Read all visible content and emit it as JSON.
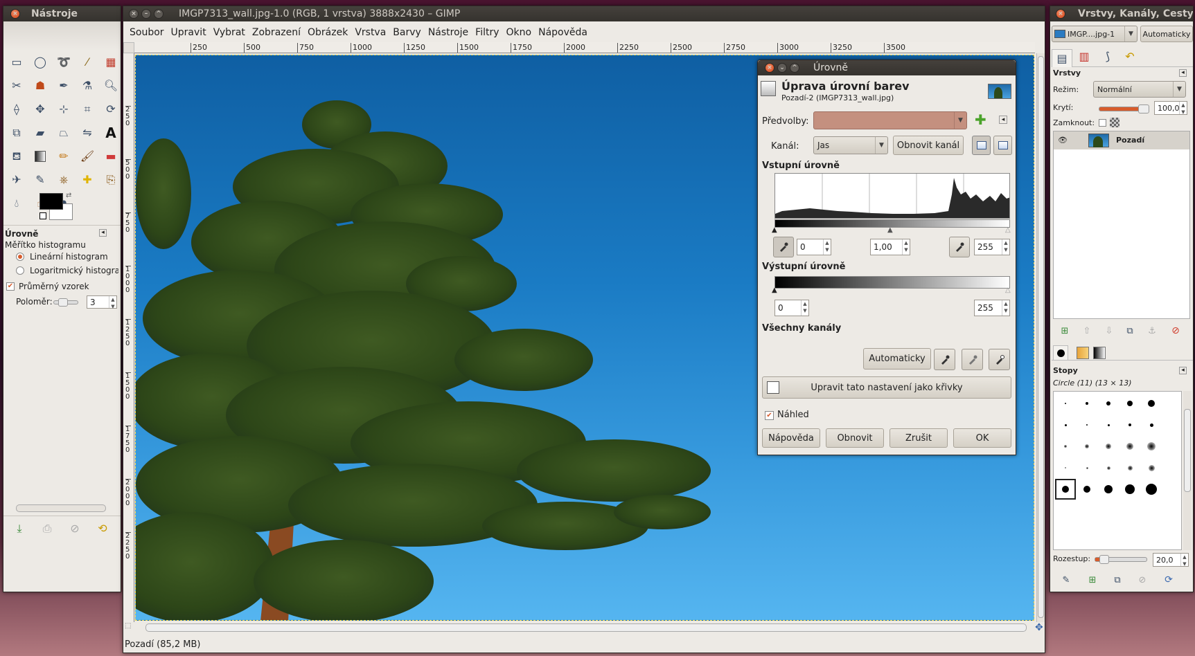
{
  "toolbox": {
    "title": "Nástroje",
    "options_title": "Úrovně",
    "histogram_scale_label": "Měřítko histogramu",
    "linear_label": "Lineární histogram",
    "log_label": "Logaritmický histogram",
    "sample_average_label": "Průměrný vzorek",
    "radius_label": "Poloměr:",
    "radius_value": "3"
  },
  "main": {
    "title": "IMGP7313_wall.jpg-1.0 (RGB, 1 vrstva) 3888x2430 – GIMP",
    "menu": [
      "Soubor",
      "Upravit",
      "Vybrat",
      "Zobrazení",
      "Obrázek",
      "Vrstva",
      "Barvy",
      "Nástroje",
      "Filtry",
      "Okno",
      "Nápověda"
    ],
    "ruler_ticks": [
      "250",
      "500",
      "750",
      "1000",
      "1250",
      "1500",
      "1750",
      "2000",
      "2250",
      "2500",
      "2750",
      "3000",
      "3250",
      "3500"
    ],
    "vruler_ticks": [
      "2 5 0",
      "5 0 0",
      "7 5 0",
      "1 0 0 0",
      "1 2 5 0",
      "1 5 0 0",
      "1 7 5 0",
      "2 0 0 0",
      "2 2 5 0"
    ],
    "status": "Pozadí (85,2 MB)"
  },
  "levels": {
    "window_title": "Úrovně",
    "heading": "Úprava úrovní barev",
    "subheading": "Pozadí-2 (IMGP7313_wall.jpg)",
    "presets_label": "Předvolby:",
    "channel_label": "Kanál:",
    "channel_value": "Jas",
    "reset_channel": "Obnovit kanál",
    "input_levels": "Vstupní úrovně",
    "input_low": "0",
    "input_gamma": "1,00",
    "input_high": "255",
    "output_levels": "Výstupní úrovně",
    "output_low": "0",
    "output_high": "255",
    "all_channels": "Všechny kanály",
    "auto": "Automaticky",
    "edit_curves": "Upravit tato nastavení jako křivky",
    "preview_label": "Náhled",
    "help": "Nápověda",
    "reset": "Obnovit",
    "cancel": "Zrušit",
    "ok": "OK"
  },
  "layers": {
    "title": "Vrstvy, Kanály, Cesty",
    "image_combo": "IMGP....jpg-1",
    "auto_button": "Automaticky",
    "section": "Vrstvy",
    "mode_label": "Režim:",
    "mode_value": "Normální",
    "opacity_label": "Krytí:",
    "opacity_value": "100,0",
    "lock_label": "Zamknout:",
    "layer_name": "Pozadí",
    "brushes_section": "Stopy",
    "brush_name": "Circle (11) (13 × 13)",
    "spacing_label": "Rozestup:",
    "spacing_value": "20,0"
  },
  "colors": {
    "sky_top": "#0e5fa2",
    "sky_bottom": "#52b4f0",
    "accent": "#d75c2c",
    "preset_fill": "#c4907f"
  }
}
